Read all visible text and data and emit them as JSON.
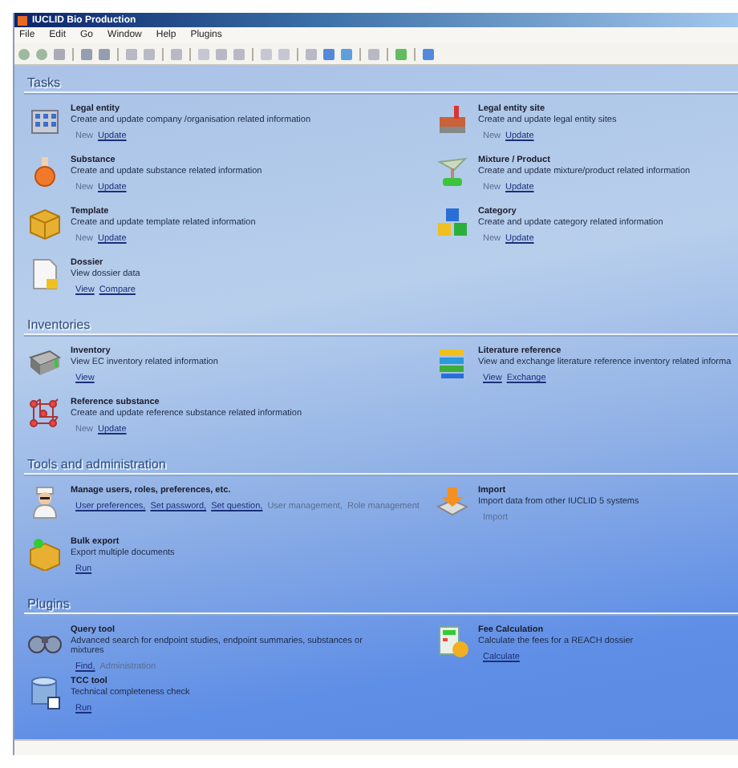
{
  "window": {
    "title": "IUCLID Bio Production"
  },
  "menu": [
    "File",
    "Edit",
    "Go",
    "Window",
    "Help",
    "Plugins"
  ],
  "sections": [
    {
      "title": "Tasks",
      "items": [
        {
          "title": "Legal entity",
          "description": "Create and update company /organisation related information",
          "links": [
            {
              "label": "New",
              "disabled": true
            },
            {
              "label": "Update",
              "disabled": false
            }
          ]
        },
        {
          "title": "Legal entity site",
          "description": "Create and update legal entity sites",
          "links": [
            {
              "label": "New",
              "disabled": true
            },
            {
              "label": "Update",
              "disabled": false
            }
          ]
        },
        {
          "title": "Substance",
          "description": "Create and update substance related information",
          "links": [
            {
              "label": "New",
              "disabled": true
            },
            {
              "label": "Update",
              "disabled": false
            }
          ]
        },
        {
          "title": "Mixture / Product",
          "description": "Create and update mixture/product related information",
          "links": [
            {
              "label": "New",
              "disabled": true
            },
            {
              "label": "Update",
              "disabled": false
            }
          ]
        },
        {
          "title": "Template",
          "description": "Create and update template related information",
          "links": [
            {
              "label": "New",
              "disabled": true
            },
            {
              "label": "Update",
              "disabled": false
            }
          ]
        },
        {
          "title": "Category",
          "description": "Create and update category related information",
          "links": [
            {
              "label": "New",
              "disabled": true
            },
            {
              "label": "Update",
              "disabled": false
            }
          ]
        },
        {
          "title": "Dossier",
          "description": "View dossier data",
          "links": [
            {
              "label": "View",
              "disabled": false
            },
            {
              "label": "Compare",
              "disabled": false
            }
          ]
        }
      ]
    },
    {
      "title": "Inventories",
      "items": [
        {
          "title": "Inventory",
          "description": "View EC inventory related information",
          "links": [
            {
              "label": "View",
              "disabled": false
            }
          ]
        },
        {
          "title": "Literature reference",
          "description": "View and exchange literature reference inventory related informa",
          "links": [
            {
              "label": "View",
              "disabled": false
            },
            {
              "label": "Exchange",
              "disabled": false
            }
          ]
        },
        {
          "title": "Reference substance",
          "description": "Create and update reference substance related information",
          "links": [
            {
              "label": "New",
              "disabled": true
            },
            {
              "label": "Update",
              "disabled": false
            }
          ]
        }
      ]
    },
    {
      "title": "Tools and administration",
      "items": [
        {
          "title": "Manage users, roles, preferences, etc.",
          "links": [
            {
              "label": "User preferences,",
              "disabled": false
            },
            {
              "label": "Set password,",
              "disabled": false
            },
            {
              "label": "Set question,",
              "disabled": false
            },
            {
              "label": "User management,",
              "disabled": true
            },
            {
              "label": "Role management",
              "disabled": true
            }
          ]
        },
        {
          "title": "Import",
          "description": "Import data from other IUCLID 5 systems",
          "links": [
            {
              "label": "Import",
              "disabled": true
            }
          ]
        },
        {
          "title": "Bulk export",
          "description": "Export multiple documents",
          "links": [
            {
              "label": "Run",
              "disabled": false
            }
          ]
        }
      ]
    },
    {
      "title": "Plugins",
      "items": [
        {
          "title": "Query tool",
          "description": "Advanced search for endpoint studies, endpoint summaries, substances or mixtures",
          "links": [
            {
              "label": "Find,",
              "disabled": false
            },
            {
              "label": "Administration",
              "disabled": true
            }
          ]
        },
        {
          "title": "Fee Calculation",
          "description": "Calculate the fees for a REACH dossier",
          "links": [
            {
              "label": "Calculate",
              "disabled": false
            }
          ]
        },
        {
          "title": "TCC tool",
          "description": "Technical completeness check",
          "links": [
            {
              "label": "Run",
              "disabled": false
            }
          ]
        }
      ]
    }
  ]
}
